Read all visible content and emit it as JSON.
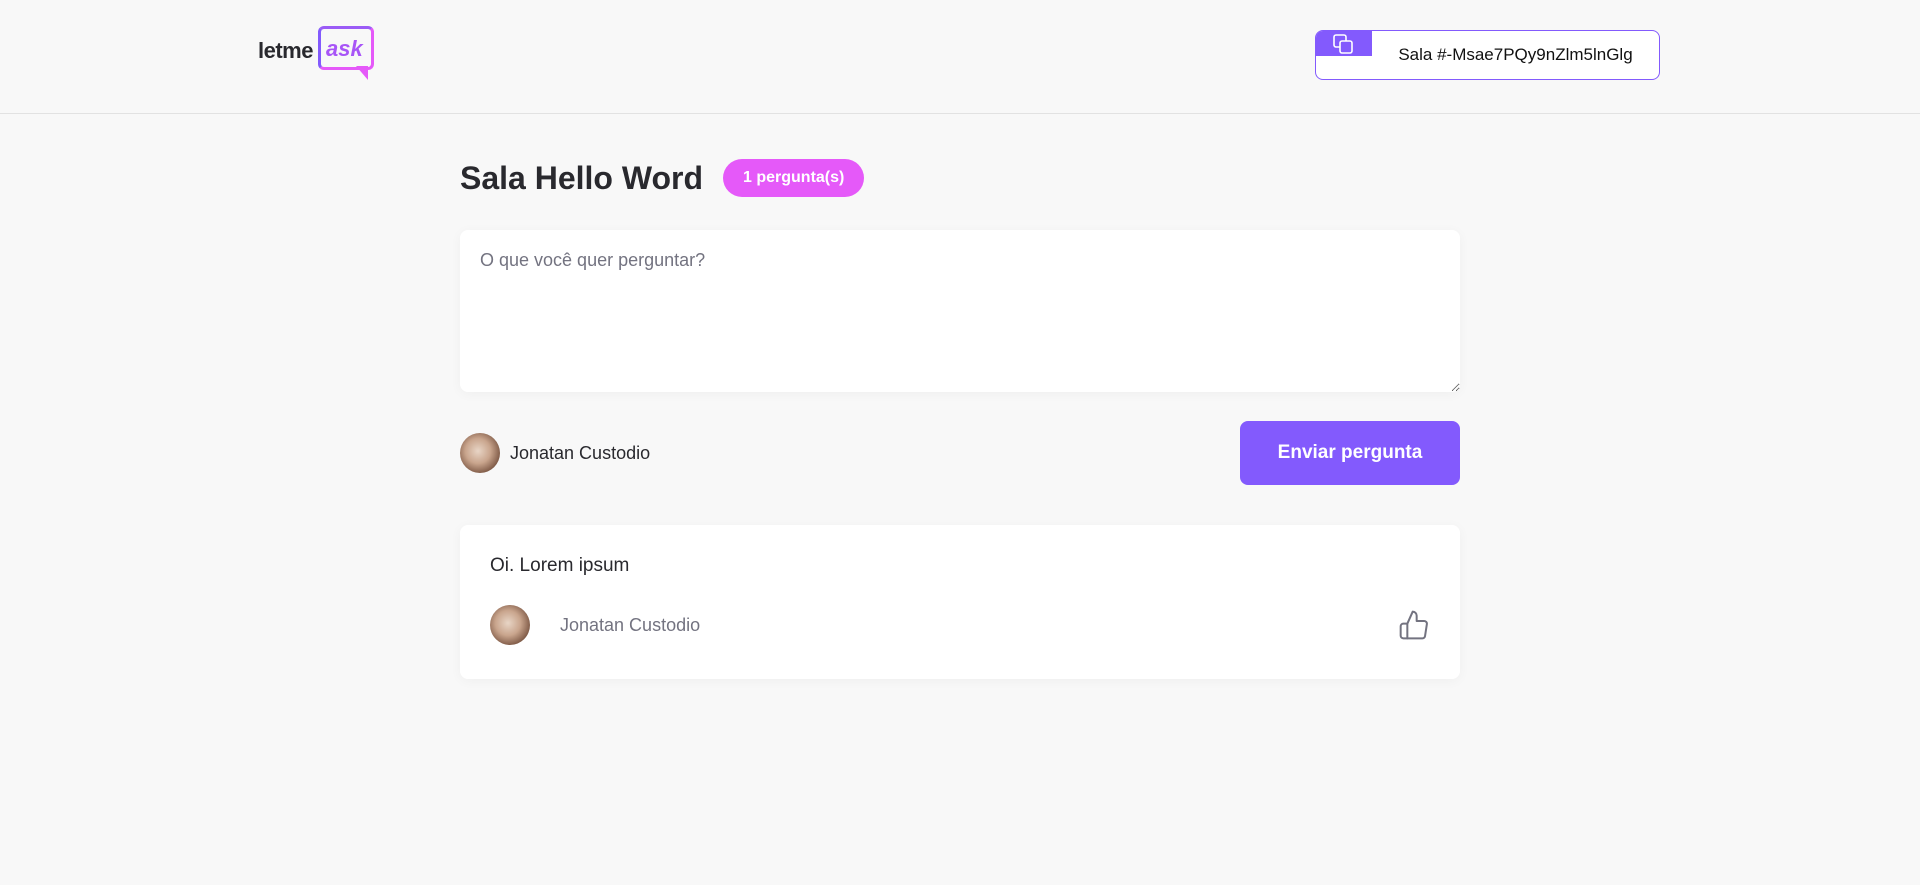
{
  "header": {
    "logo": {
      "part1": "letme",
      "part2": "ask"
    },
    "room_code": {
      "label": "Sala #-Msae7PQy9nZlm5lnGlg",
      "icon": "copy-icon"
    }
  },
  "main": {
    "title": "Sala Hello Word",
    "question_count": "1 pergunta(s)",
    "form": {
      "placeholder": "O que você quer perguntar?",
      "value": "",
      "user_name": "Jonatan Custodio",
      "submit_label": "Enviar pergunta"
    },
    "questions": [
      {
        "content": "Oi. Lorem ipsum",
        "author": "Jonatan Custodio",
        "like_icon": "thumbs-up-icon"
      }
    ]
  },
  "colors": {
    "accent": "#835afd",
    "badge": "#e559f9",
    "background": "#f8f8f8"
  }
}
